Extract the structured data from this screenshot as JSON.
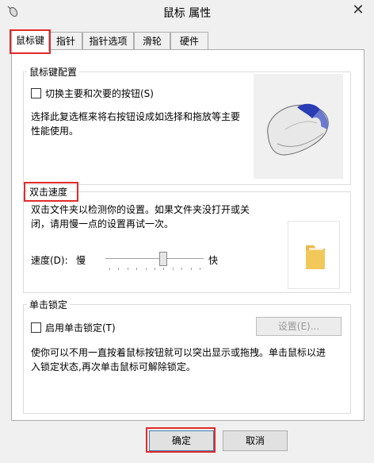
{
  "window": {
    "title": "鼠标 属性",
    "close_glyph": "✕"
  },
  "tabs": [
    {
      "label": "鼠标键",
      "active": true
    },
    {
      "label": "指针"
    },
    {
      "label": "指针选项"
    },
    {
      "label": "滑轮"
    },
    {
      "label": "硬件"
    }
  ],
  "button_config": {
    "title": "鼠标键配置",
    "swap_checkbox_label": "切换主要和次要的按钮(S)",
    "swap_checked": false,
    "description_line1": "选择此复选框来将右按钮设成如选择和拖放等主要",
    "description_line2": "性能使用。"
  },
  "double_click": {
    "title": "双击速度",
    "description_line1": "双击文件夹以检测你的设置。如果文件夹没打开或关",
    "description_line2": "闭，请用慢一点的设置再试一次。",
    "speed_label": "速度(D):",
    "slow_label": "慢",
    "fast_label": "快",
    "speed_value": 0.6
  },
  "click_lock": {
    "title": "单击锁定",
    "checkbox_label": "启用单击锁定(T)",
    "checked": false,
    "settings_button": "设置(E)...",
    "description_line1": "使你可以不用一直按着鼠标按钮就可以突出显示或拖拽。单击鼠标以进",
    "description_line2": "入锁定状态,再次单击鼠标可解除锁定。"
  },
  "footer": {
    "ok_button": "确定",
    "cancel_button": "取消"
  },
  "colors": {
    "highlight": "#e02a2a",
    "folder": "#f2c85b",
    "mouse_accent": "#2a3db5"
  }
}
